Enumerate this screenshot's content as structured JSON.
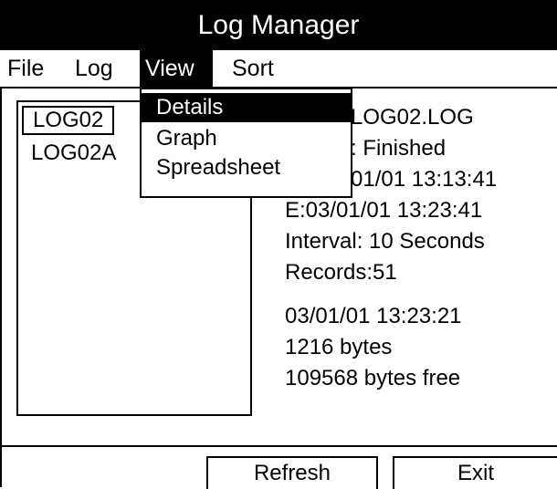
{
  "window": {
    "title": "Log Manager"
  },
  "menubar": {
    "items": [
      {
        "label": "File"
      },
      {
        "label": "Log"
      },
      {
        "label": "View"
      },
      {
        "label": "Sort"
      }
    ]
  },
  "view_menu": {
    "items": [
      {
        "label": "Details"
      },
      {
        "label": "Graph"
      },
      {
        "label": "Spreadsheet"
      }
    ]
  },
  "log_list": {
    "items": [
      {
        "label": "LOG02"
      },
      {
        "label": "LOG02A"
      }
    ]
  },
  "details": {
    "filename": "LOG02.LOG",
    "status": ": Finished",
    "start": "01/01 13:13:41",
    "end": "E:03/01/01 13:23:41",
    "interval": "Interval: 10 Seconds",
    "records": "Records:51",
    "modified": "03/01/01 13:23:21",
    "size": "1216 bytes",
    "free": "109568 bytes free"
  },
  "softkeys": {
    "refresh": "Refresh",
    "exit": "Exit"
  }
}
